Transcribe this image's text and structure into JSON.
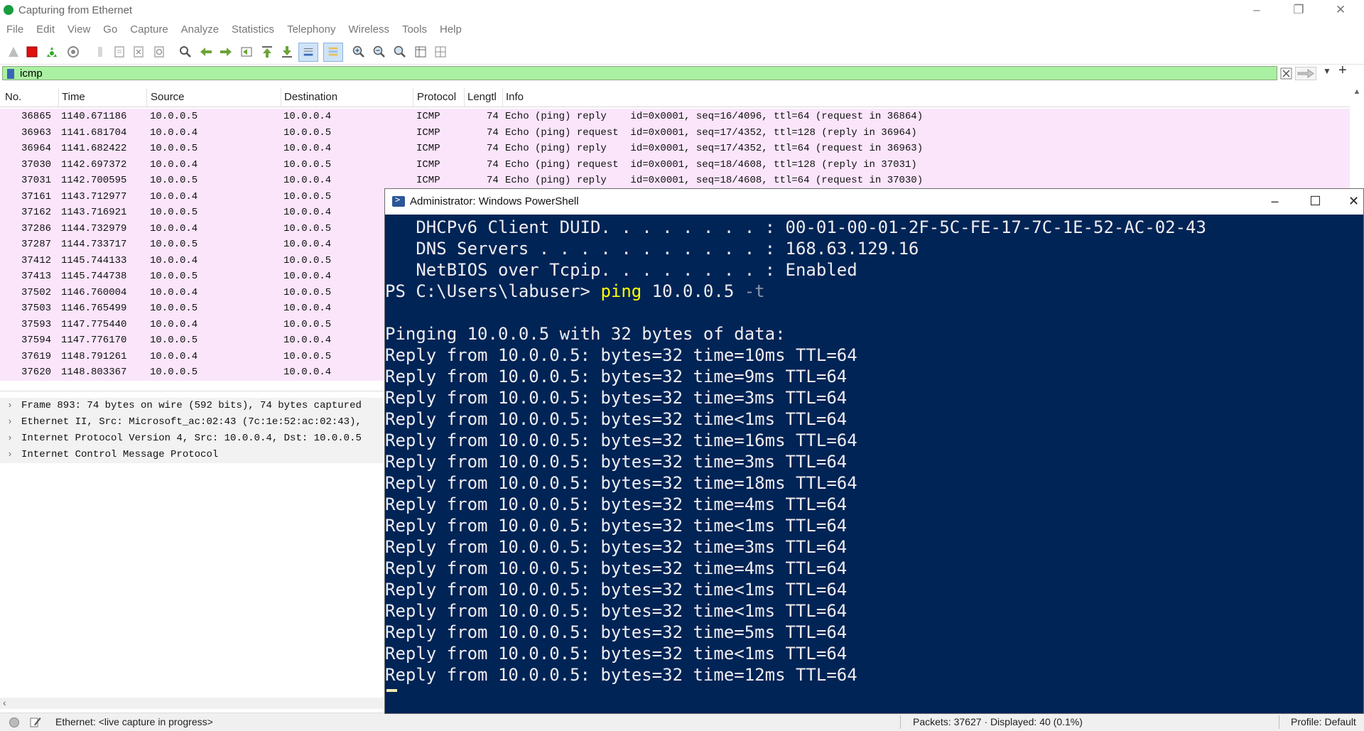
{
  "wireshark": {
    "title": "Capturing from Ethernet",
    "menus": [
      "File",
      "Edit",
      "View",
      "Go",
      "Capture",
      "Analyze",
      "Statistics",
      "Telephony",
      "Wireless",
      "Tools",
      "Help"
    ],
    "filter": {
      "value": "icmp"
    },
    "columns": [
      "No.",
      "Time",
      "Source",
      "Destination",
      "Protocol",
      "Lengtl",
      "Info"
    ],
    "packets": [
      {
        "no": "36865",
        "time": "1140.671186",
        "src": "10.0.0.5",
        "dst": "10.0.0.4",
        "proto": "ICMP",
        "len": "74",
        "info": "Echo (ping) reply    id=0x0001, seq=16/4096, ttl=64 (request in 36864)"
      },
      {
        "no": "36963",
        "time": "1141.681704",
        "src": "10.0.0.4",
        "dst": "10.0.0.5",
        "proto": "ICMP",
        "len": "74",
        "info": "Echo (ping) request  id=0x0001, seq=17/4352, ttl=128 (reply in 36964)"
      },
      {
        "no": "36964",
        "time": "1141.682422",
        "src": "10.0.0.5",
        "dst": "10.0.0.4",
        "proto": "ICMP",
        "len": "74",
        "info": "Echo (ping) reply    id=0x0001, seq=17/4352, ttl=64 (request in 36963)"
      },
      {
        "no": "37030",
        "time": "1142.697372",
        "src": "10.0.0.4",
        "dst": "10.0.0.5",
        "proto": "ICMP",
        "len": "74",
        "info": "Echo (ping) request  id=0x0001, seq=18/4608, ttl=128 (reply in 37031)"
      },
      {
        "no": "37031",
        "time": "1142.700595",
        "src": "10.0.0.5",
        "dst": "10.0.0.4",
        "proto": "ICMP",
        "len": "74",
        "info": "Echo (ping) reply    id=0x0001, seq=18/4608, ttl=64 (request in 37030)"
      },
      {
        "no": "37161",
        "time": "1143.712977",
        "src": "10.0.0.4",
        "dst": "10.0.0.5",
        "proto": "",
        "len": "",
        "info": ""
      },
      {
        "no": "37162",
        "time": "1143.716921",
        "src": "10.0.0.5",
        "dst": "10.0.0.4",
        "proto": "",
        "len": "",
        "info": ""
      },
      {
        "no": "37286",
        "time": "1144.732979",
        "src": "10.0.0.4",
        "dst": "10.0.0.5",
        "proto": "",
        "len": "",
        "info": ""
      },
      {
        "no": "37287",
        "time": "1144.733717",
        "src": "10.0.0.5",
        "dst": "10.0.0.4",
        "proto": "",
        "len": "",
        "info": ""
      },
      {
        "no": "37412",
        "time": "1145.744133",
        "src": "10.0.0.4",
        "dst": "10.0.0.5",
        "proto": "",
        "len": "",
        "info": ""
      },
      {
        "no": "37413",
        "time": "1145.744738",
        "src": "10.0.0.5",
        "dst": "10.0.0.4",
        "proto": "",
        "len": "",
        "info": ""
      },
      {
        "no": "37502",
        "time": "1146.760004",
        "src": "10.0.0.4",
        "dst": "10.0.0.5",
        "proto": "",
        "len": "",
        "info": ""
      },
      {
        "no": "37503",
        "time": "1146.765499",
        "src": "10.0.0.5",
        "dst": "10.0.0.4",
        "proto": "",
        "len": "",
        "info": ""
      },
      {
        "no": "37593",
        "time": "1147.775440",
        "src": "10.0.0.4",
        "dst": "10.0.0.5",
        "proto": "",
        "len": "",
        "info": ""
      },
      {
        "no": "37594",
        "time": "1147.776170",
        "src": "10.0.0.5",
        "dst": "10.0.0.4",
        "proto": "",
        "len": "",
        "info": ""
      },
      {
        "no": "37619",
        "time": "1148.791261",
        "src": "10.0.0.4",
        "dst": "10.0.0.5",
        "proto": "",
        "len": "",
        "info": ""
      },
      {
        "no": "37620",
        "time": "1148.803367",
        "src": "10.0.0.5",
        "dst": "10.0.0.4",
        "proto": "",
        "len": "",
        "info": ""
      }
    ],
    "details": [
      "Frame 893: 74 bytes on wire (592 bits), 74 bytes captured",
      "Ethernet II, Src: Microsoft_ac:02:43 (7c:1e:52:ac:02:43),",
      "Internet Protocol Version 4, Src: 10.0.0.4, Dst: 10.0.0.5",
      "Internet Control Message Protocol"
    ],
    "status": {
      "capture": "Ethernet: <live capture in progress>",
      "packets": "Packets: 37627 · Displayed: 40 (0.1%)",
      "profile": "Profile: Default"
    },
    "colors": {
      "row_bg": "#fae5fb",
      "filter_bg": "#aaf0a2"
    }
  },
  "powershell": {
    "title": "Administrator: Windows PowerShell",
    "lines": [
      {
        "text": "   DHCPv6 Client DUID. . . . . . . . : 00-01-00-01-2F-5C-FE-17-7C-1E-52-AC-02-43"
      },
      {
        "text": "   DNS Servers . . . . . . . . . . . : 168.63.129.16"
      },
      {
        "text": "   NetBIOS over Tcpip. . . . . . . . : Enabled"
      },
      {
        "prompt": "PS C:\\Users\\labuser> ",
        "cmd": "ping",
        "args": " 10.0.0.5",
        "flag": " -t"
      },
      {
        "text": ""
      },
      {
        "text": "Pinging 10.0.0.5 with 32 bytes of data:"
      },
      {
        "text": "Reply from 10.0.0.5: bytes=32 time=10ms TTL=64"
      },
      {
        "text": "Reply from 10.0.0.5: bytes=32 time=9ms TTL=64"
      },
      {
        "text": "Reply from 10.0.0.5: bytes=32 time=3ms TTL=64"
      },
      {
        "text": "Reply from 10.0.0.5: bytes=32 time<1ms TTL=64"
      },
      {
        "text": "Reply from 10.0.0.5: bytes=32 time=16ms TTL=64"
      },
      {
        "text": "Reply from 10.0.0.5: bytes=32 time=3ms TTL=64"
      },
      {
        "text": "Reply from 10.0.0.5: bytes=32 time=18ms TTL=64"
      },
      {
        "text": "Reply from 10.0.0.5: bytes=32 time=4ms TTL=64"
      },
      {
        "text": "Reply from 10.0.0.5: bytes=32 time<1ms TTL=64"
      },
      {
        "text": "Reply from 10.0.0.5: bytes=32 time=3ms TTL=64"
      },
      {
        "text": "Reply from 10.0.0.5: bytes=32 time=4ms TTL=64"
      },
      {
        "text": "Reply from 10.0.0.5: bytes=32 time<1ms TTL=64"
      },
      {
        "text": "Reply from 10.0.0.5: bytes=32 time<1ms TTL=64"
      },
      {
        "text": "Reply from 10.0.0.5: bytes=32 time=5ms TTL=64"
      },
      {
        "text": "Reply from 10.0.0.5: bytes=32 time<1ms TTL=64"
      },
      {
        "text": "Reply from 10.0.0.5: bytes=32 time=12ms TTL=64"
      }
    ],
    "colors": {
      "background": "#012456",
      "command": "#ffff00"
    }
  }
}
